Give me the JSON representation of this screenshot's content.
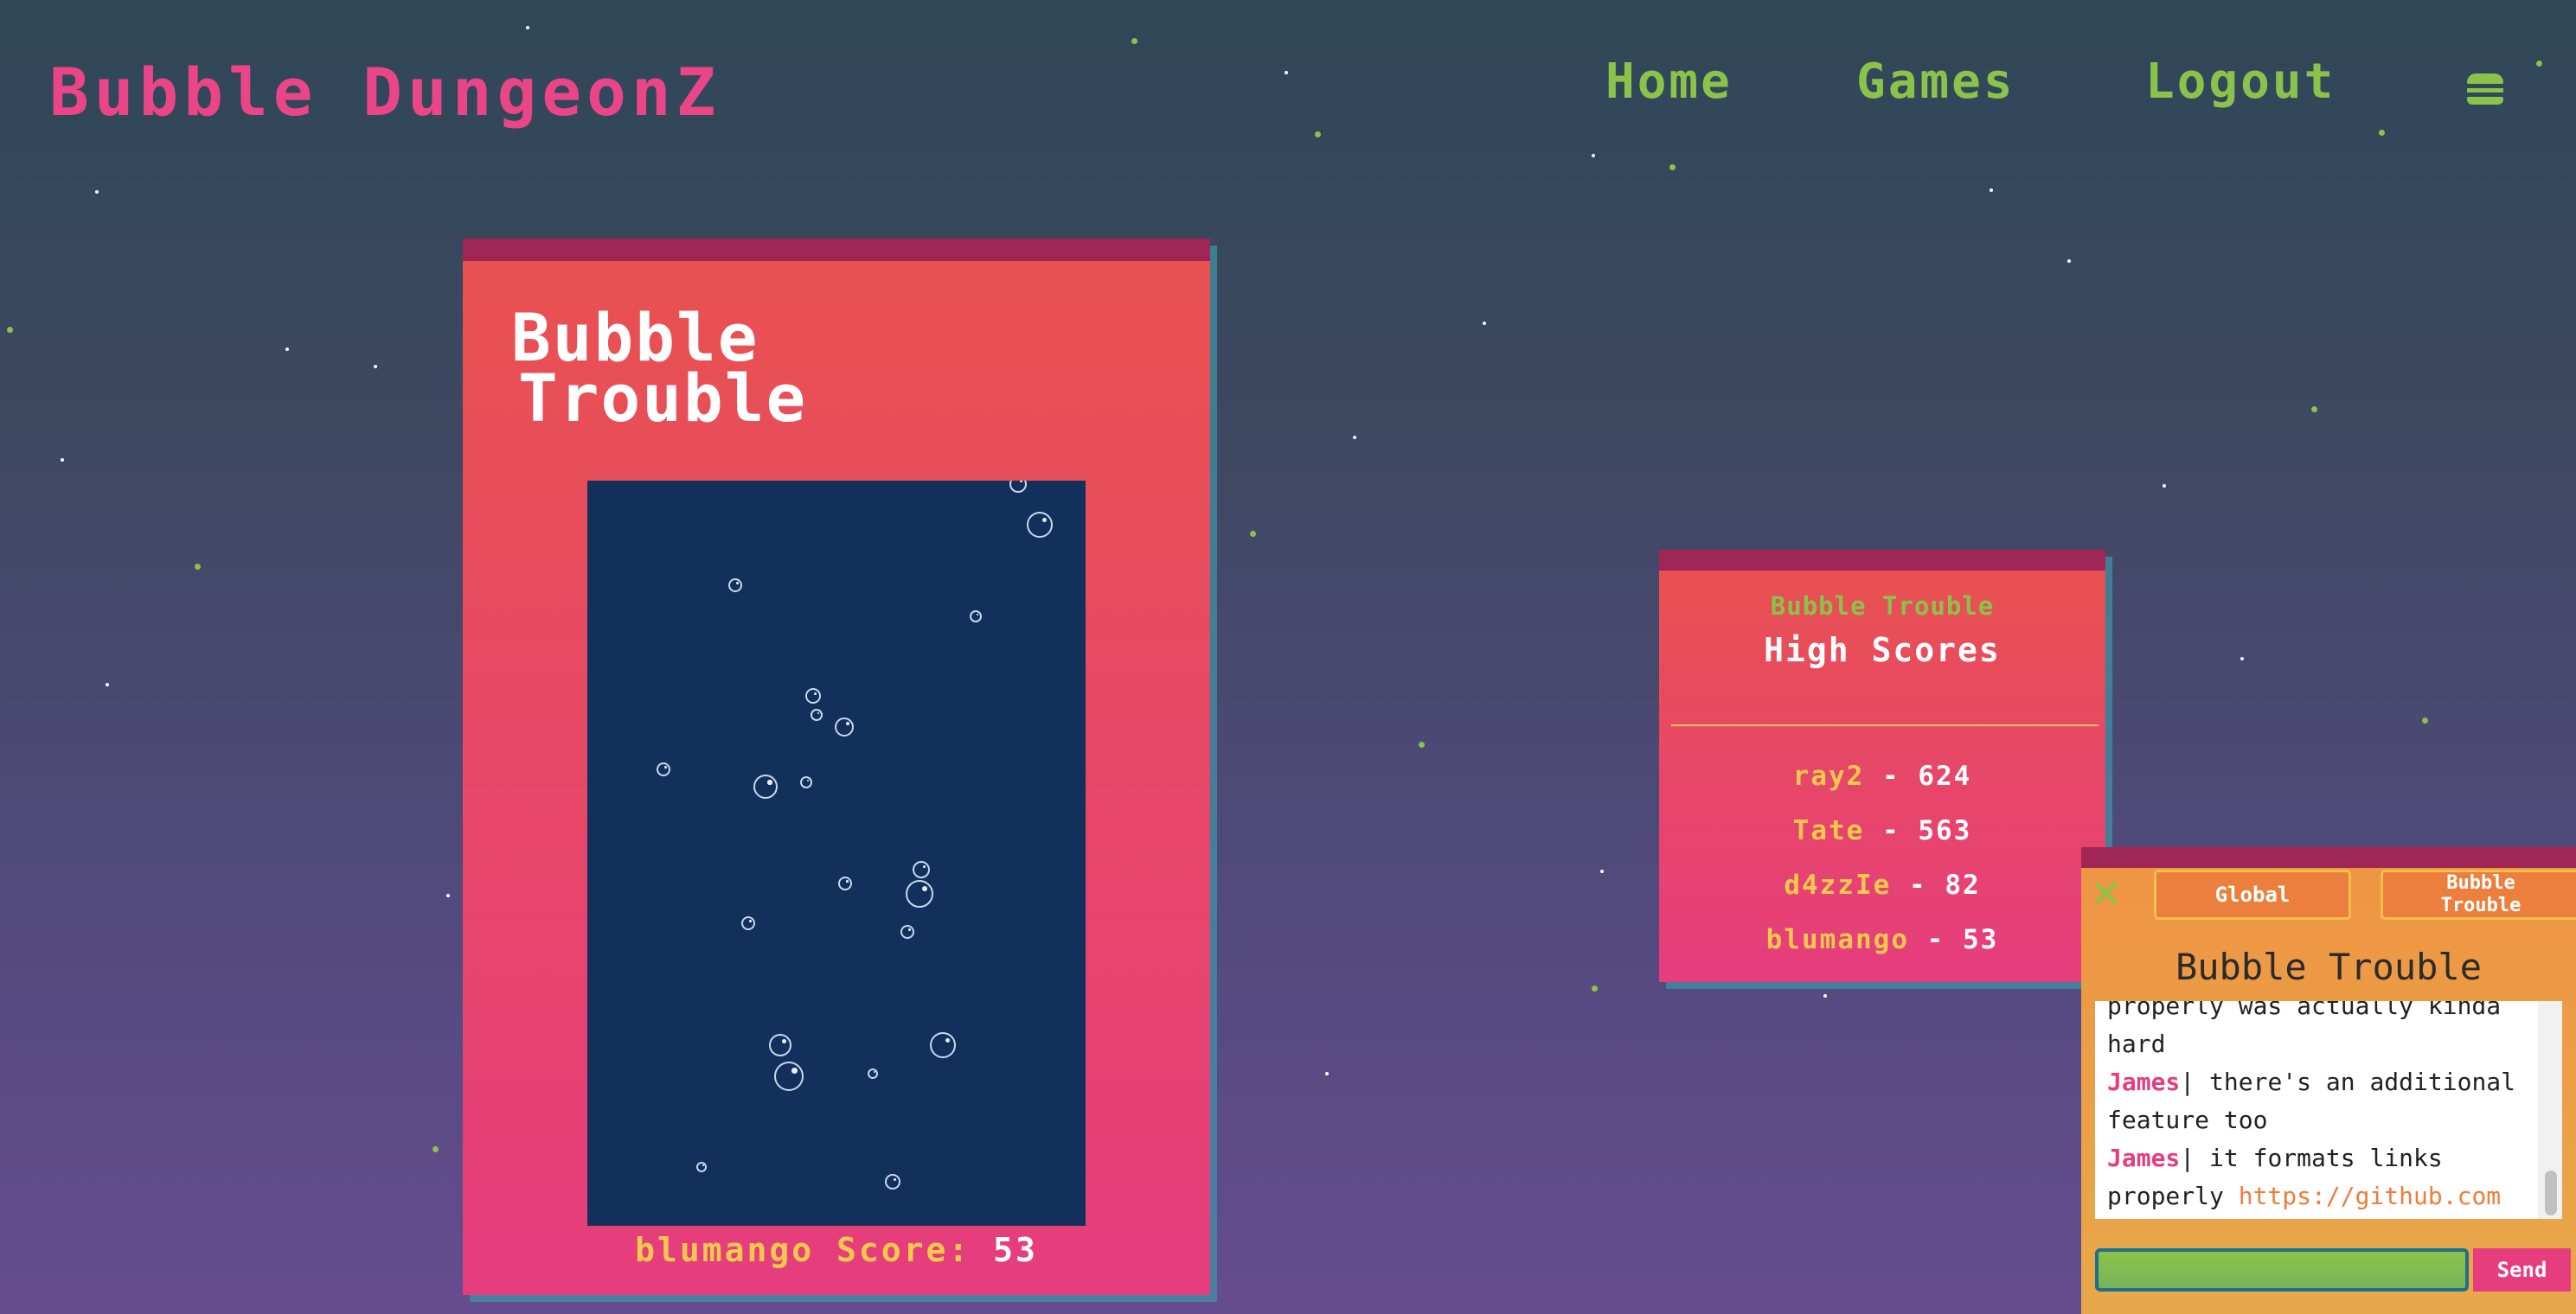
{
  "header": {
    "logo": "Bubble DungeonZ",
    "nav": {
      "home": "Home",
      "games": "Games",
      "logout": "Logout"
    },
    "menu_icon": "hamburger-menu-icon"
  },
  "game": {
    "title_line1": "Bubble",
    "title_line2": "Trouble",
    "player": "blumango",
    "score_label": "Score:",
    "score": "53"
  },
  "high_scores": {
    "game_name": "Bubble Trouble",
    "heading": "High Scores",
    "separator": "-",
    "entries": [
      {
        "name": "ray2",
        "score": "624"
      },
      {
        "name": "Tate",
        "score": "563"
      },
      {
        "name": "d4zzIe",
        "score": "82"
      },
      {
        "name": "blumango",
        "score": "53"
      }
    ]
  },
  "chat": {
    "close_icon": "close-x-icon",
    "tabs": {
      "global": "Global",
      "game_line1": "Bubble",
      "game_line2": "Trouble"
    },
    "title": "Bubble Trouble",
    "messages": {
      "partial_line1": "properly was actually kinda",
      "partial_line2": "hard",
      "msg1_user": "James",
      "msg1_text": "| there's an additional feature too",
      "msg2_user": "James",
      "msg2_text": "| it formats links properly ",
      "msg2_link": "https://github.com"
    },
    "input_value": "",
    "send_label": "Send"
  },
  "colors": {
    "accent_pink": "#e94587",
    "accent_green": "#8bc34a",
    "accent_yellow": "#f2c94c",
    "game_canvas": "#13305d",
    "card_top_bar": "#a02655"
  }
}
